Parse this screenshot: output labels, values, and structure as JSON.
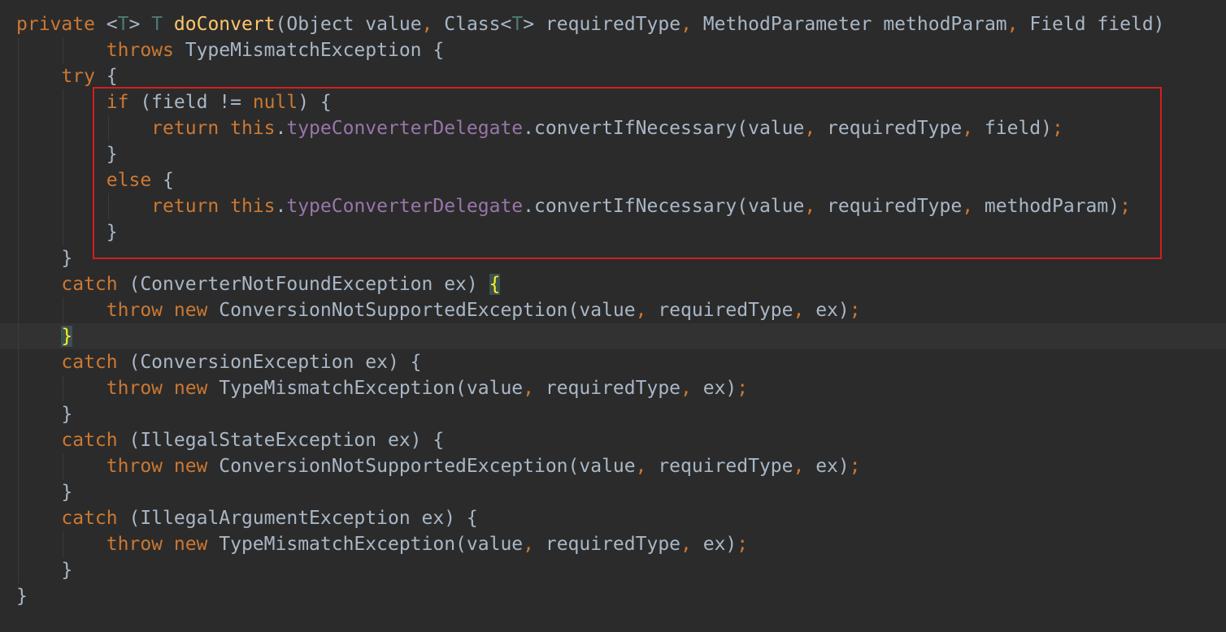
{
  "editor": {
    "lines": [
      {
        "indent": 0,
        "guides": 0,
        "tokens": [
          {
            "t": "private ",
            "c": "kw"
          },
          {
            "t": "<",
            "c": "plain"
          },
          {
            "t": "T",
            "c": "tp"
          },
          {
            "t": "> ",
            "c": "plain"
          },
          {
            "t": "T ",
            "c": "tp"
          },
          {
            "t": "doConvert",
            "c": "fn"
          },
          {
            "t": "(Object value",
            "c": "plain"
          },
          {
            "t": ", ",
            "c": "kw"
          },
          {
            "t": "Class<",
            "c": "plain"
          },
          {
            "t": "T",
            "c": "tp"
          },
          {
            "t": "> requiredType",
            "c": "plain"
          },
          {
            "t": ", ",
            "c": "kw"
          },
          {
            "t": "MethodParameter methodParam",
            "c": "plain"
          },
          {
            "t": ", ",
            "c": "kw"
          },
          {
            "t": "Field field)",
            "c": "plain"
          }
        ]
      },
      {
        "indent": 2,
        "guides": 2,
        "tokens": [
          {
            "t": "throws ",
            "c": "kw"
          },
          {
            "t": "TypeMismatchException {",
            "c": "plain"
          }
        ]
      },
      {
        "indent": 1,
        "guides": 1,
        "tokens": [
          {
            "t": "try ",
            "c": "kw"
          },
          {
            "t": "{",
            "c": "plain"
          }
        ]
      },
      {
        "indent": 2,
        "guides": 2,
        "tokens": [
          {
            "t": "if ",
            "c": "kw"
          },
          {
            "t": "(field != ",
            "c": "plain"
          },
          {
            "t": "null",
            "c": "kw"
          },
          {
            "t": ") {",
            "c": "plain"
          }
        ]
      },
      {
        "indent": 3,
        "guides": 3,
        "tokens": [
          {
            "t": "return this",
            "c": "kw"
          },
          {
            "t": ".",
            "c": "plain"
          },
          {
            "t": "typeConverterDelegate",
            "c": "fld"
          },
          {
            "t": ".convertIfNecessary(value",
            "c": "plain"
          },
          {
            "t": ", ",
            "c": "kw"
          },
          {
            "t": "requiredType",
            "c": "plain"
          },
          {
            "t": ", ",
            "c": "kw"
          },
          {
            "t": "field)",
            "c": "plain"
          },
          {
            "t": ";",
            "c": "kw"
          }
        ]
      },
      {
        "indent": 2,
        "guides": 2,
        "tokens": [
          {
            "t": "}",
            "c": "plain"
          }
        ]
      },
      {
        "indent": 2,
        "guides": 2,
        "tokens": [
          {
            "t": "else ",
            "c": "kw"
          },
          {
            "t": "{",
            "c": "plain"
          }
        ]
      },
      {
        "indent": 3,
        "guides": 3,
        "tokens": [
          {
            "t": "return this",
            "c": "kw"
          },
          {
            "t": ".",
            "c": "plain"
          },
          {
            "t": "typeConverterDelegate",
            "c": "fld"
          },
          {
            "t": ".convertIfNecessary(value",
            "c": "plain"
          },
          {
            "t": ", ",
            "c": "kw"
          },
          {
            "t": "requiredType",
            "c": "plain"
          },
          {
            "t": ", ",
            "c": "kw"
          },
          {
            "t": "methodParam)",
            "c": "plain"
          },
          {
            "t": ";",
            "c": "kw"
          }
        ]
      },
      {
        "indent": 2,
        "guides": 2,
        "tokens": [
          {
            "t": "}",
            "c": "plain"
          }
        ]
      },
      {
        "indent": 1,
        "guides": 1,
        "tokens": [
          {
            "t": "}",
            "c": "plain"
          }
        ]
      },
      {
        "indent": 1,
        "guides": 1,
        "tokens": [
          {
            "t": "catch ",
            "c": "kw"
          },
          {
            "t": "(ConverterNotFoundException ex) ",
            "c": "plain"
          },
          {
            "t": "{",
            "c": "brace-hl"
          }
        ]
      },
      {
        "indent": 2,
        "guides": 2,
        "tokens": [
          {
            "t": "throw new ",
            "c": "kw"
          },
          {
            "t": "ConversionNotSupportedException(value",
            "c": "plain"
          },
          {
            "t": ", ",
            "c": "kw"
          },
          {
            "t": "requiredType",
            "c": "plain"
          },
          {
            "t": ", ",
            "c": "kw"
          },
          {
            "t": "ex)",
            "c": "plain"
          },
          {
            "t": ";",
            "c": "kw"
          }
        ]
      },
      {
        "indent": 1,
        "guides": 1,
        "current": true,
        "tokens": [
          {
            "t": "}",
            "c": "brace-hl"
          }
        ]
      },
      {
        "indent": 1,
        "guides": 1,
        "tokens": [
          {
            "t": "catch ",
            "c": "kw"
          },
          {
            "t": "(ConversionException ex) {",
            "c": "plain"
          }
        ]
      },
      {
        "indent": 2,
        "guides": 2,
        "tokens": [
          {
            "t": "throw new ",
            "c": "kw"
          },
          {
            "t": "TypeMismatchException(value",
            "c": "plain"
          },
          {
            "t": ", ",
            "c": "kw"
          },
          {
            "t": "requiredType",
            "c": "plain"
          },
          {
            "t": ", ",
            "c": "kw"
          },
          {
            "t": "ex)",
            "c": "plain"
          },
          {
            "t": ";",
            "c": "kw"
          }
        ]
      },
      {
        "indent": 1,
        "guides": 1,
        "tokens": [
          {
            "t": "}",
            "c": "plain"
          }
        ]
      },
      {
        "indent": 1,
        "guides": 1,
        "tokens": [
          {
            "t": "catch ",
            "c": "kw"
          },
          {
            "t": "(IllegalStateException ex) {",
            "c": "plain"
          }
        ]
      },
      {
        "indent": 2,
        "guides": 2,
        "tokens": [
          {
            "t": "throw new ",
            "c": "kw"
          },
          {
            "t": "ConversionNotSupportedException(value",
            "c": "plain"
          },
          {
            "t": ", ",
            "c": "kw"
          },
          {
            "t": "requiredType",
            "c": "plain"
          },
          {
            "t": ", ",
            "c": "kw"
          },
          {
            "t": "ex)",
            "c": "plain"
          },
          {
            "t": ";",
            "c": "kw"
          }
        ]
      },
      {
        "indent": 1,
        "guides": 1,
        "tokens": [
          {
            "t": "}",
            "c": "plain"
          }
        ]
      },
      {
        "indent": 1,
        "guides": 1,
        "tokens": [
          {
            "t": "catch ",
            "c": "kw"
          },
          {
            "t": "(IllegalArgumentException ex) {",
            "c": "plain"
          }
        ]
      },
      {
        "indent": 2,
        "guides": 2,
        "tokens": [
          {
            "t": "throw new ",
            "c": "kw"
          },
          {
            "t": "TypeMismatchException(value",
            "c": "plain"
          },
          {
            "t": ", ",
            "c": "kw"
          },
          {
            "t": "requiredType",
            "c": "plain"
          },
          {
            "t": ", ",
            "c": "kw"
          },
          {
            "t": "ex)",
            "c": "plain"
          },
          {
            "t": ";",
            "c": "kw"
          }
        ]
      },
      {
        "indent": 1,
        "guides": 1,
        "tokens": [
          {
            "t": "}",
            "c": "plain"
          }
        ]
      },
      {
        "indent": 0,
        "guides": 0,
        "tokens": [
          {
            "t": "}",
            "c": "plain"
          }
        ]
      }
    ]
  },
  "colors": {
    "background": "#2b2b2b",
    "keyword": "#cc7832",
    "method_declaration": "#ffc66d",
    "type_parameter": "#507874",
    "field": "#9876aa",
    "default_text": "#a9b7c6",
    "highlight_box": "#d21f1f"
  }
}
